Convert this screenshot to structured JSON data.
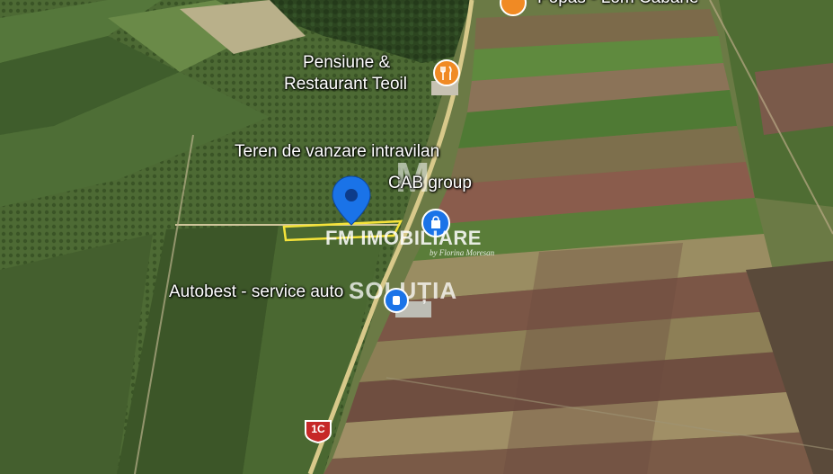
{
  "map": {
    "labels": {
      "top_poi": "Popas - Lom Cabane",
      "restaurant_line1": "Pensiune &",
      "restaurant_line2": "Restaurant Teoil",
      "listing": "Teren de vanzare intravilan",
      "cab_group": "CAB group",
      "service": "Autobest - service auto",
      "road_shield": "1C"
    },
    "icons": {
      "restaurant": "fork-knife-icon",
      "location_pin": "location-pin-icon",
      "shop": "shopping-bag-icon",
      "service": "car-service-icon",
      "route_shield": "route-shield-icon"
    },
    "colors": {
      "pin_blue": "#1a73e8",
      "poi_orange": "#f08a24",
      "road": "#d8c98a",
      "parcel_outline": "#f5e33a",
      "shield_red": "#c62828"
    }
  },
  "watermark": {
    "logo_letter": "M",
    "brand": "FM IMOBILIARE",
    "byline": "by Florina Moresan",
    "sub_brand": "SOLUȚIA"
  }
}
